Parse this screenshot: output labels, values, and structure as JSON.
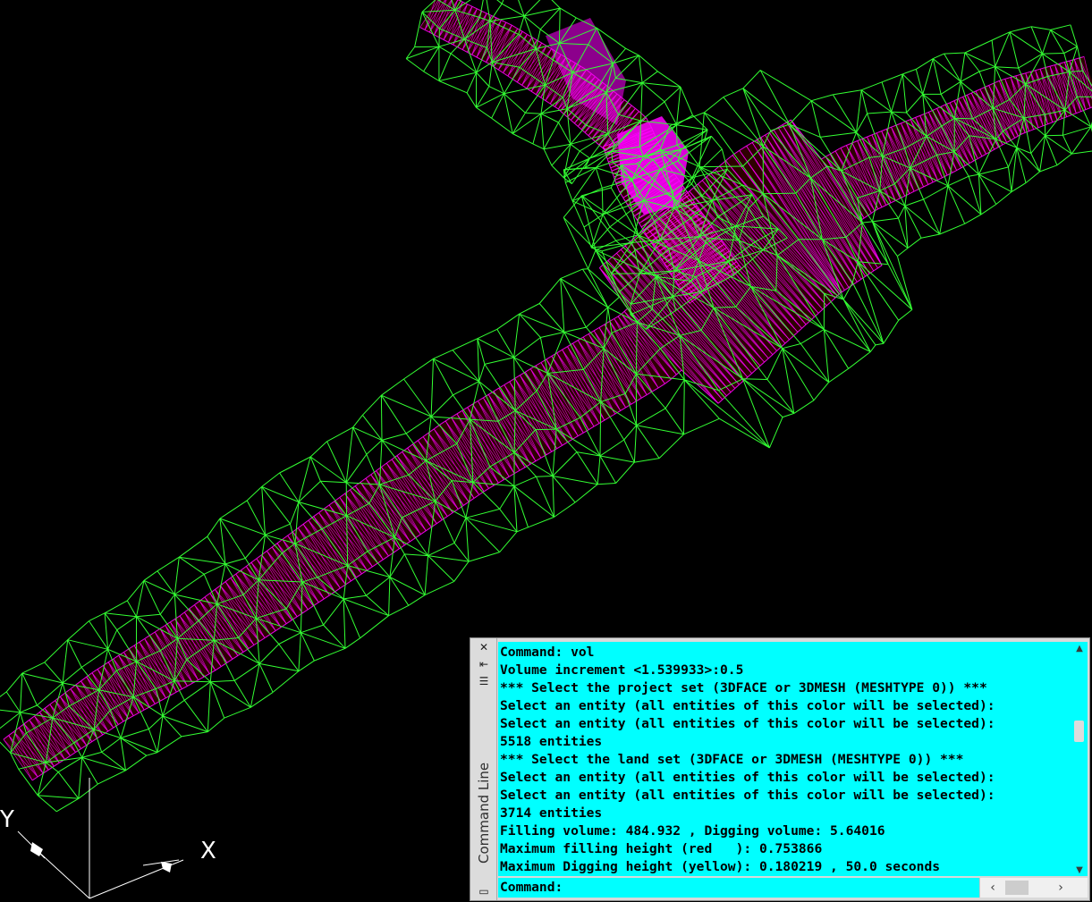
{
  "drawing": {
    "background": "#000000",
    "tin_color": "#33ff33",
    "project_color": "#ff00ff",
    "fill_color": "#ff0000",
    "dig_color": "#ffff00",
    "ucs_icon": {
      "x_label": "X",
      "y_label": "Y"
    }
  },
  "command_palette": {
    "title": "Command Line",
    "close_icon": "close-icon",
    "history": [
      "Command: vol",
      "Volume increment <1.539933>:0.5",
      "*** Select the project set (3DFACE or 3DMESH (MESHTYPE 0)) ***",
      "Select an entity (all entities of this color will be selected):",
      "Select an entity (all entities of this color will be selected):",
      "5518 entities",
      "*** Select the land set (3DFACE or 3DMESH (MESHTYPE 0)) ***",
      "Select an entity (all entities of this color will be selected):",
      "Select an entity (all entities of this color will be selected):",
      "3714 entities",
      "Filling volume: 484.932 , Digging volume: 5.64016",
      "Maximum filling height (red   ): 0.753866",
      "Maximum Digging height (yellow): 0.180219 , 50.0 seconds"
    ],
    "prompt": "Command:",
    "input_value": "",
    "history_bg": "#00ffff"
  }
}
